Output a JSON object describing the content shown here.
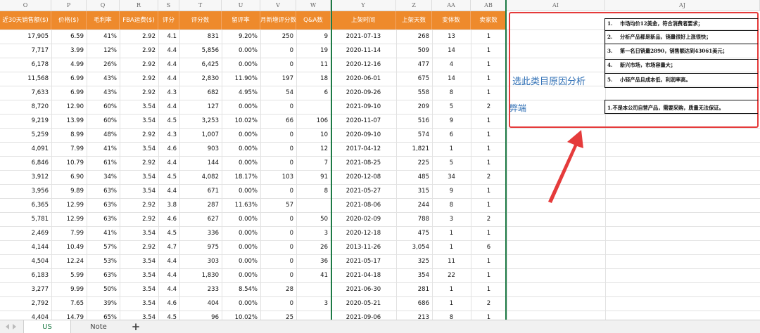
{
  "column_letters": [
    "O",
    "P",
    "Q",
    "R",
    "S",
    "T",
    "U",
    "V",
    "W",
    "Y",
    "Z",
    "AA",
    "AB",
    "AI",
    "AJ"
  ],
  "headers": [
    "近30天销售额($)",
    "价格($)",
    "毛利率",
    "FBA运费($)",
    "评分",
    "评分数",
    "留评率",
    "月新增评分数",
    "Q&A数",
    "上架时间",
    "上架天数",
    "变体数",
    "卖家数"
  ],
  "rows": [
    [
      "17,905",
      "6.59",
      "41%",
      "2.92",
      "4.1",
      "831",
      "9.20%",
      "250",
      "9",
      "2021-07-13",
      "268",
      "13",
      "1"
    ],
    [
      "7,717",
      "3.99",
      "12%",
      "2.92",
      "4.4",
      "5,856",
      "0.00%",
      "0",
      "19",
      "2020-11-14",
      "509",
      "14",
      "1"
    ],
    [
      "6,178",
      "4.99",
      "26%",
      "2.92",
      "4.4",
      "6,425",
      "0.00%",
      "0",
      "11",
      "2020-12-16",
      "477",
      "4",
      "1"
    ],
    [
      "11,568",
      "6.99",
      "43%",
      "2.92",
      "4.4",
      "2,830",
      "11.90%",
      "197",
      "18",
      "2020-06-01",
      "675",
      "14",
      "1"
    ],
    [
      "7,633",
      "6.99",
      "43%",
      "2.92",
      "4.3",
      "682",
      "4.95%",
      "54",
      "6",
      "2020-09-26",
      "558",
      "8",
      "1"
    ],
    [
      "8,720",
      "12.90",
      "60%",
      "3.54",
      "4.4",
      "127",
      "0.00%",
      "0",
      "",
      "2021-09-10",
      "209",
      "5",
      "2"
    ],
    [
      "9,219",
      "13.99",
      "60%",
      "3.54",
      "4.5",
      "3,253",
      "10.02%",
      "66",
      "106",
      "2020-11-07",
      "516",
      "9",
      "1"
    ],
    [
      "5,259",
      "8.99",
      "48%",
      "2.92",
      "4.3",
      "1,007",
      "0.00%",
      "0",
      "10",
      "2020-09-10",
      "574",
      "6",
      "1"
    ],
    [
      "4,091",
      "7.99",
      "41%",
      "3.54",
      "4.6",
      "903",
      "0.00%",
      "0",
      "12",
      "2017-04-12",
      "1,821",
      "1",
      "1"
    ],
    [
      "6,846",
      "10.79",
      "61%",
      "2.92",
      "4.4",
      "144",
      "0.00%",
      "0",
      "7",
      "2021-08-25",
      "225",
      "5",
      "1"
    ],
    [
      "3,912",
      "6.90",
      "34%",
      "3.54",
      "4.5",
      "4,082",
      "18.17%",
      "103",
      "91",
      "2020-12-08",
      "485",
      "34",
      "2"
    ],
    [
      "3,956",
      "9.89",
      "63%",
      "3.54",
      "4.4",
      "671",
      "0.00%",
      "0",
      "8",
      "2021-05-27",
      "315",
      "9",
      "1"
    ],
    [
      "6,365",
      "12.99",
      "63%",
      "2.92",
      "3.8",
      "287",
      "11.63%",
      "57",
      "",
      "2021-08-06",
      "244",
      "8",
      "1"
    ],
    [
      "5,781",
      "12.99",
      "63%",
      "2.92",
      "4.6",
      "627",
      "0.00%",
      "0",
      "50",
      "2020-02-09",
      "788",
      "3",
      "2"
    ],
    [
      "2,469",
      "7.99",
      "41%",
      "3.54",
      "4.5",
      "336",
      "0.00%",
      "0",
      "3",
      "2020-12-18",
      "475",
      "1",
      "1"
    ],
    [
      "4,144",
      "10.49",
      "57%",
      "2.92",
      "4.7",
      "975",
      "0.00%",
      "0",
      "26",
      "2013-11-26",
      "3,054",
      "1",
      "6"
    ],
    [
      "4,504",
      "12.24",
      "53%",
      "3.54",
      "4.4",
      "303",
      "0.00%",
      "0",
      "36",
      "2021-05-17",
      "325",
      "11",
      "1"
    ],
    [
      "6,183",
      "5.99",
      "63%",
      "3.54",
      "4.4",
      "1,830",
      "0.00%",
      "0",
      "41",
      "2021-04-18",
      "354",
      "22",
      "1"
    ],
    [
      "3,277",
      "9.99",
      "50%",
      "3.54",
      "4.4",
      "233",
      "8.54%",
      "28",
      "",
      "2021-06-30",
      "281",
      "1",
      "1"
    ],
    [
      "2,792",
      "7.65",
      "39%",
      "3.54",
      "4.6",
      "404",
      "0.00%",
      "0",
      "3",
      "2020-05-21",
      "686",
      "1",
      "2"
    ],
    [
      "4,404",
      "14.79",
      "65%",
      "3.54",
      "4.5",
      "96",
      "10.02%",
      "25",
      "",
      "2021-09-06",
      "213",
      "8",
      "1"
    ]
  ],
  "panel": {
    "title": "选此类目原因分析",
    "con_title": "弊端",
    "reasons": [
      {
        "num": "1.",
        "text": "市场均价12美金，符合消费者要求；"
      },
      {
        "num": "2.",
        "text": "分析产品都是新品，销量很好上涨很快；"
      },
      {
        "num": "3.",
        "text": "第一名日销量2890，销售额达到43061美元；"
      },
      {
        "num": "4.",
        "text": "新兴市场，市场容量大；"
      },
      {
        "num": "5.",
        "text": "小轻产品且成本低，利润率高。"
      }
    ],
    "con": "1.不是本公司自营产品，需要采购，质量无法保证。"
  },
  "tabs": [
    {
      "label": "US",
      "active": true
    },
    {
      "label": "Note",
      "active": false
    }
  ],
  "add_sheet_label": "+",
  "colors": {
    "header_orange": "#ee8a2c",
    "panel_red": "#e53b3b",
    "title_blue": "#2f6fb5",
    "active_tab_green": "#1d7a45"
  }
}
